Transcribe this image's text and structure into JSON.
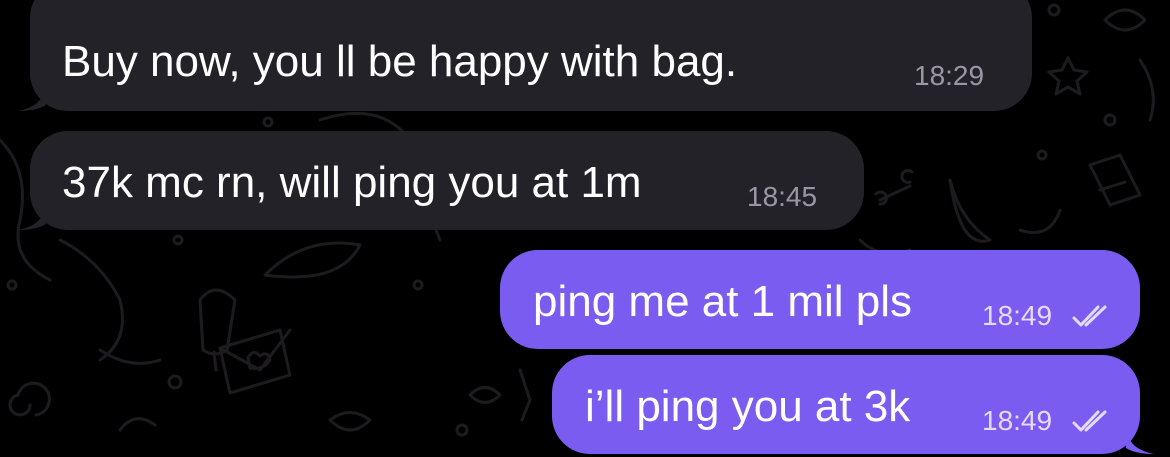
{
  "colors": {
    "background": "#000000",
    "incoming_bubble": "#242229",
    "outgoing_bubble": "#7b5cf0",
    "incoming_time": "#9a97a3",
    "outgoing_time": "#e4dcff",
    "wallpaper_doodle": "#1d1b20"
  },
  "messages": [
    {
      "direction": "incoming",
      "text": "Buy now, you ll be happy with bag.",
      "time": "18:29"
    },
    {
      "direction": "incoming",
      "text": "37k mc rn, will ping you at 1m",
      "time": "18:45"
    },
    {
      "direction": "outgoing",
      "text": "ping me at 1 mil pls",
      "time": "18:49",
      "status_icon": "double-check-icon"
    },
    {
      "direction": "outgoing",
      "text": "i’ll ping you at 3k",
      "time": "18:49",
      "status_icon": "double-check-icon"
    }
  ]
}
